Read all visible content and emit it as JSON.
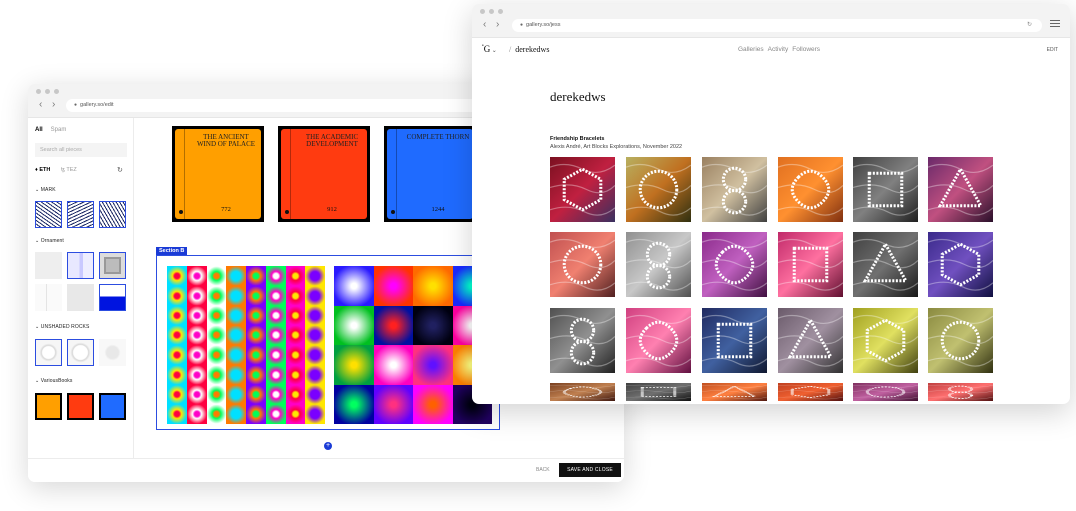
{
  "editor_window": {
    "url": "gallery.so/edit",
    "sidebar": {
      "tab_all": "All",
      "tab_spam": "Spam",
      "search_placeholder": "Search all pieces",
      "chain_eth": "ETH",
      "chain_tez": "TEZ",
      "groups": [
        "MARK",
        "Ornament",
        "UNSHADED ROCKS",
        "VariousBooks"
      ]
    },
    "books": [
      {
        "title": "THE ANCIENT WIND OF PALACE",
        "number": "772",
        "color": "#ff9f00"
      },
      {
        "title": "THE ACADEMIC DEVELOPMENT",
        "number": "912",
        "color": "#ff3b10"
      },
      {
        "title": "COMPLETE THORN",
        "number": "1244",
        "color": "#1f6bff"
      }
    ],
    "section_label": "Section B",
    "back_label": "BACK",
    "save_label": "SAVE AND CLOSE"
  },
  "profile_window": {
    "url": "gallery.so/jess",
    "logo": "G",
    "username_crumb": "derekedws",
    "nav": [
      "Galleries",
      "Activity",
      "Followers"
    ],
    "edit_label": "EDIT",
    "username": "derekedws",
    "collection_title": "Friendship Bracelets",
    "collection_subtitle": "Alexis André, Art Blocks Explorations, November 2022"
  },
  "colors": {
    "accent": "#1a3bd6",
    "save_button": "#111111"
  }
}
